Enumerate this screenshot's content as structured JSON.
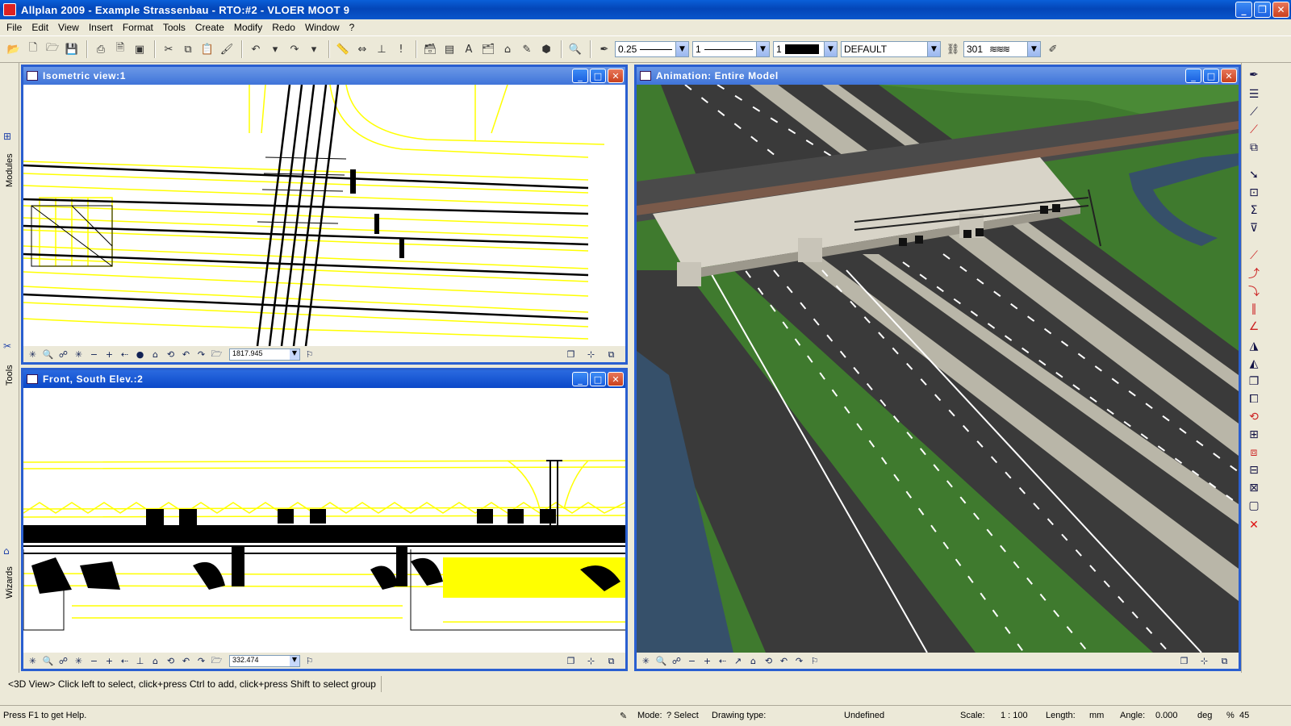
{
  "window": {
    "title": "Allplan 2009 - Example Strassenbau - RTO:#2 - VLOER MOOT 9"
  },
  "menu": [
    "File",
    "Edit",
    "View",
    "Insert",
    "Format",
    "Tools",
    "Create",
    "Modify",
    "Redo",
    "Window",
    "?"
  ],
  "toolbar": {
    "pen_thickness": "0.25",
    "line_type": "1",
    "color_number": "1",
    "layer": "DEFAULT",
    "pattern_number": "301"
  },
  "left_palette": {
    "modules": "Modules",
    "tools": "Tools",
    "wizards": "Wizards"
  },
  "views": {
    "isometric": {
      "title": "Isometric view:1",
      "zoom": "1817.945"
    },
    "front": {
      "title": "Front, South Elev.:2",
      "zoom": "332.474"
    },
    "animation": {
      "title": "Animation: Entire Model"
    }
  },
  "prompt": "<3D View> Click left to select, click+press Ctrl to add, click+press Shift to select group",
  "status": {
    "help": "Press F1 to get Help.",
    "mode_label": "Mode:",
    "mode_value": "? Select",
    "drawing_type_label": "Drawing type:",
    "drawing_type_value": "Undefined",
    "scale_label": "Scale:",
    "scale_value": "1 : 100",
    "length_label": "Length:",
    "length_value": "mm",
    "angle_label": "Angle:",
    "angle_value": "0.000",
    "angle_unit": "deg",
    "percent_label": "%",
    "percent_value": "45"
  },
  "colors": {
    "titlebar": "#0a56cc",
    "wireframe": "#ffff00",
    "grass": "#3f7a2e",
    "asphalt": "#3a3a3a"
  }
}
